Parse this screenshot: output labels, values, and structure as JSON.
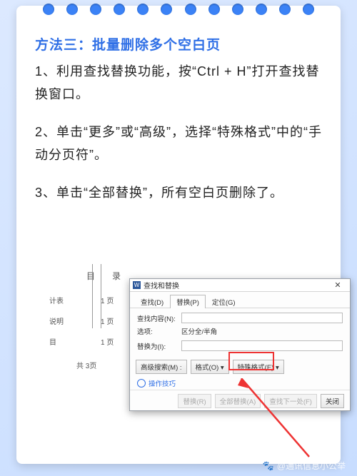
{
  "title": "方法三：批量删除多个空白页",
  "steps": [
    "1、利用查找替换功能，按“Ctrl + H”打开查找替换窗口。",
    "2、单击“更多”或“高级”，选择“特殊格式”中的“手动分页符”。",
    "3、单击“全部替换”，所有空白页删除了。"
  ],
  "doc": {
    "toc_title": "目　录",
    "rows": [
      {
        "label": "计表",
        "page": "1 页"
      },
      {
        "label": "说明",
        "page": "1 页"
      },
      {
        "label": "目",
        "page": "1 页"
      }
    ],
    "total": "共  3页"
  },
  "dialog": {
    "window_title": "查找和替换",
    "tabs": {
      "find": "查找(D)",
      "replace": "替换(P)",
      "goto": "定位(G)"
    },
    "labels": {
      "find_what": "查找内容(N):",
      "options": "选项:",
      "options_value": "区分全/半角",
      "replace_with": "替换为(I):"
    },
    "buttons": {
      "more": "高级搜索(M) :",
      "format": "格式(O) ▾",
      "special": "特殊格式(E) ▾",
      "replace": "替换(R)",
      "replace_all": "全部替换(A)",
      "find_next": "查找下一处(F)",
      "close": "关闭"
    },
    "help": "操作技巧"
  },
  "watermark": "@通讯信息小公举"
}
